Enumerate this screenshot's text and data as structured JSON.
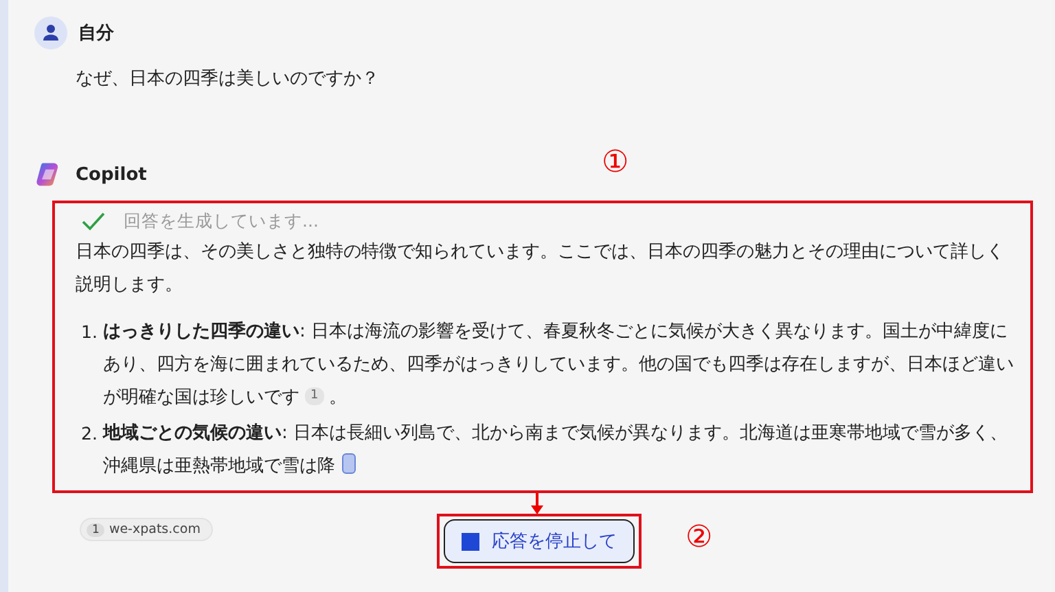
{
  "user": {
    "name": "自分",
    "message": "なぜ、日本の四季は美しいのですか？"
  },
  "assistant": {
    "name": "Copilot",
    "status": {
      "text": "回答を生成しています...",
      "done": true
    },
    "intro": "日本の四季は、その美しさと独特の特徴で知られています。ここでは、日本の四季の魅力とその理由について詳しく説明します。",
    "items": [
      {
        "number": "1.",
        "title": "はっきりした四季の違い",
        "text": ": 日本は海流の影響を受けて、春夏秋冬ごとに気候が大きく異なります。国土が中緯度にあり、四方を海に囲まれているため、四季がはっきりしています。他の国でも四季は存在しますが、日本ほど違いが明確な国は珍しいです",
        "citation": "1",
        "after": "。",
        "typing": false
      },
      {
        "number": "2.",
        "title": "地域ごとの気候の違い",
        "text": ": 日本は長細い列島で、北から南まで気候が異なります。北海道は亜寒帯地域で雪が多く、沖縄県は亜熱帯地域で雪は降",
        "typing": true
      }
    ],
    "sources": [
      {
        "number": "1",
        "site": "we-xpats.com"
      }
    ],
    "stop_button": "応答を停止して"
  },
  "annotations": [
    {
      "label": "①"
    },
    {
      "label": "②"
    }
  ]
}
